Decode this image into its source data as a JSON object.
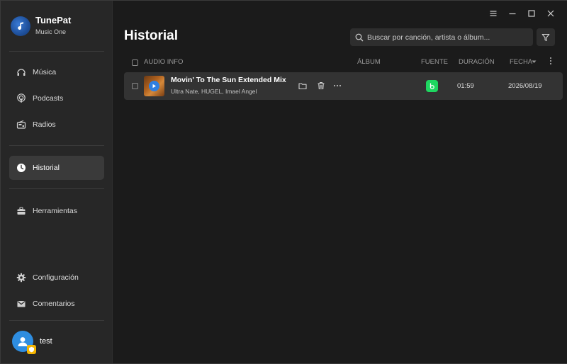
{
  "brand": {
    "title": "TunePat",
    "subtitle": "Music One"
  },
  "sidebar": {
    "items": [
      {
        "label": "Música",
        "icon": "music-icon"
      },
      {
        "label": "Podcasts",
        "icon": "podcast-icon"
      },
      {
        "label": "Radios",
        "icon": "radio-icon"
      },
      {
        "label": "Historial",
        "icon": "clock-icon",
        "active": true
      },
      {
        "label": "Herramientas",
        "icon": "toolbox-icon"
      },
      {
        "label": "Configuración",
        "icon": "gear-icon"
      },
      {
        "label": "Comentarios",
        "icon": "mail-icon"
      }
    ]
  },
  "user": {
    "name": "test"
  },
  "main": {
    "title": "Historial",
    "search_placeholder": "Buscar por canción, artista o álbum...",
    "columns": {
      "audio_info": "AUDIO INFO",
      "album": "ÁLBUM",
      "source": "FUENTE",
      "duration": "DURACIÓN",
      "date": "FECHA"
    },
    "rows": [
      {
        "title": "Movin' To The Sun Extended Mix",
        "artist": "Ultra Nate, HUGEL, Imael Angel",
        "album": "",
        "source_icon": "spotify-icon",
        "duration": "01:59",
        "date": "2026/08/19"
      }
    ]
  },
  "colors": {
    "accent": "#2f7fe0",
    "source_green": "#1ed760",
    "sidebar_bg": "#272727",
    "main_bg": "#1b1b1b",
    "row_bg": "#333333"
  }
}
